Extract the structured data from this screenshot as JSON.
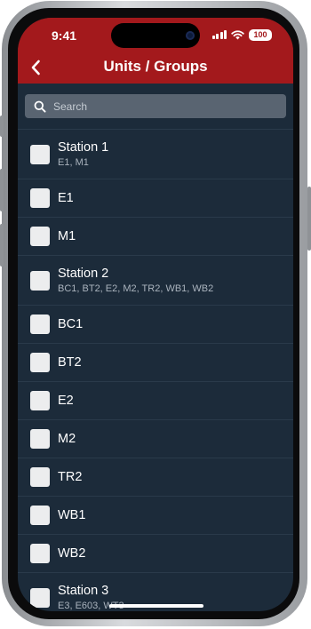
{
  "status": {
    "time": "9:41",
    "battery": "100"
  },
  "header": {
    "title": "Units / Groups"
  },
  "search": {
    "placeholder": "Search"
  },
  "list": {
    "items": [
      {
        "title": "Station 1",
        "subtitle": "E1, M1",
        "type": "group"
      },
      {
        "title": "E1",
        "subtitle": "",
        "type": "unit"
      },
      {
        "title": "M1",
        "subtitle": "",
        "type": "unit"
      },
      {
        "title": "Station 2",
        "subtitle": "BC1, BT2, E2, M2, TR2, WB1, WB2",
        "type": "group"
      },
      {
        "title": "BC1",
        "subtitle": "",
        "type": "unit"
      },
      {
        "title": "BT2",
        "subtitle": "",
        "type": "unit"
      },
      {
        "title": "E2",
        "subtitle": "",
        "type": "unit"
      },
      {
        "title": "M2",
        "subtitle": "",
        "type": "unit"
      },
      {
        "title": "TR2",
        "subtitle": "",
        "type": "unit"
      },
      {
        "title": "WB1",
        "subtitle": "",
        "type": "unit"
      },
      {
        "title": "WB2",
        "subtitle": "",
        "type": "unit"
      },
      {
        "title": "Station 3",
        "subtitle": "E3, E603, WT3",
        "type": "group"
      }
    ]
  },
  "colors": {
    "header": "#a3191c",
    "background": "#1c2b3a",
    "search": "#596471",
    "checkbox": "#ecedee"
  }
}
